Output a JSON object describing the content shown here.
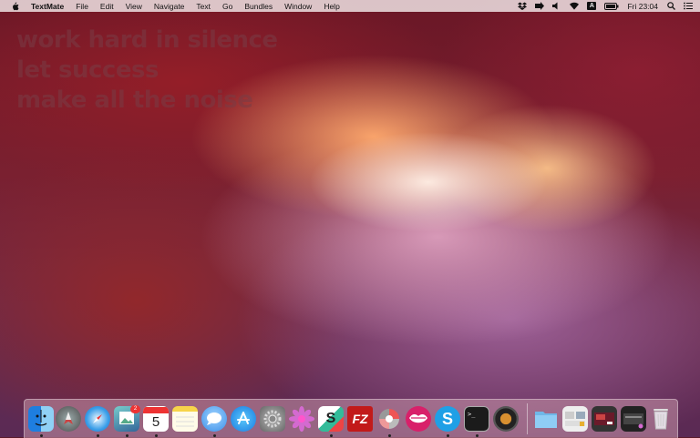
{
  "menubar": {
    "app_name": "TextMate",
    "menus": [
      "File",
      "Edit",
      "View",
      "Navigate",
      "Text",
      "Go",
      "Bundles",
      "Window",
      "Help"
    ],
    "clock": "Fri 23:04",
    "input_source": "A",
    "status_icons": [
      "dropbox-icon",
      "arrow-icon",
      "volume-icon",
      "wifi-icon",
      "input-source-icon",
      "battery-icon",
      "search-icon",
      "notification-list-icon"
    ]
  },
  "wallpaper": {
    "quote_lines": [
      "work hard in silence",
      "let success",
      "make all the noise"
    ]
  },
  "dock": {
    "apps": [
      {
        "name": "finder-icon",
        "running": true
      },
      {
        "name": "launchpad-icon",
        "running": false
      },
      {
        "name": "safari-icon",
        "running": true
      },
      {
        "name": "preview-icon",
        "running": true,
        "badge": "2"
      },
      {
        "name": "calendar-icon",
        "running": true,
        "text": "5"
      },
      {
        "name": "notes-icon",
        "running": false
      },
      {
        "name": "messages-icon",
        "running": true
      },
      {
        "name": "app-store-icon",
        "running": false
      },
      {
        "name": "system-preferences-icon",
        "running": false
      },
      {
        "name": "flower-app-icon",
        "running": false
      },
      {
        "name": "slides-app-icon",
        "running": true,
        "text": "S"
      },
      {
        "name": "filezilla-icon",
        "running": false,
        "text": "FZ"
      },
      {
        "name": "pinwheel-app-icon",
        "running": true
      },
      {
        "name": "lips-app-icon",
        "running": false
      },
      {
        "name": "skype-icon",
        "running": true,
        "text": "S"
      },
      {
        "name": "terminal-icon",
        "running": true,
        "text": ">_"
      },
      {
        "name": "speaker-app-icon",
        "running": false
      }
    ],
    "stacks": [
      {
        "name": "folder-stack-icon"
      },
      {
        "name": "documents-stack-icon"
      },
      {
        "name": "screenshot-stack-icon"
      },
      {
        "name": "downloads-stack-icon"
      },
      {
        "name": "trash-icon"
      }
    ]
  }
}
